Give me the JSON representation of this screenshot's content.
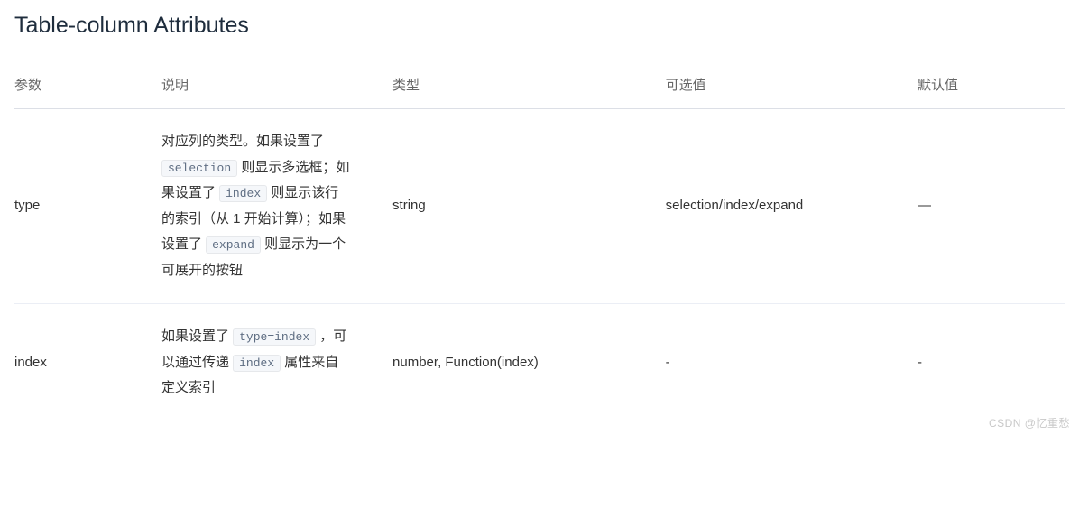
{
  "title": "Table-column Attributes",
  "headers": {
    "param": "参数",
    "desc": "说明",
    "type": "类型",
    "options": "可选值",
    "default": "默认值"
  },
  "rows": [
    {
      "param": "type",
      "desc_parts": [
        {
          "text": "对应列的类型。如果设置了 "
        },
        {
          "code": "selection"
        },
        {
          "text": " 则显示多选框；如果设置了 "
        },
        {
          "code": "index"
        },
        {
          "text": " 则显示该行的索引（从 1 开始计算）；如果设置了 "
        },
        {
          "code": "expand"
        },
        {
          "text": " 则显示为一个可展开的按钮"
        }
      ],
      "type": "string",
      "options": "selection/index/expand",
      "default": "—"
    },
    {
      "param": "index",
      "desc_parts": [
        {
          "text": "如果设置了 "
        },
        {
          "code": "type=index"
        },
        {
          "text": " ，可以通过传递 "
        },
        {
          "code": "index"
        },
        {
          "text": " 属性来自定义索引"
        }
      ],
      "type": "number, Function(index)",
      "options": "-",
      "default": "-"
    }
  ],
  "watermark": "CSDN @忆重愁"
}
